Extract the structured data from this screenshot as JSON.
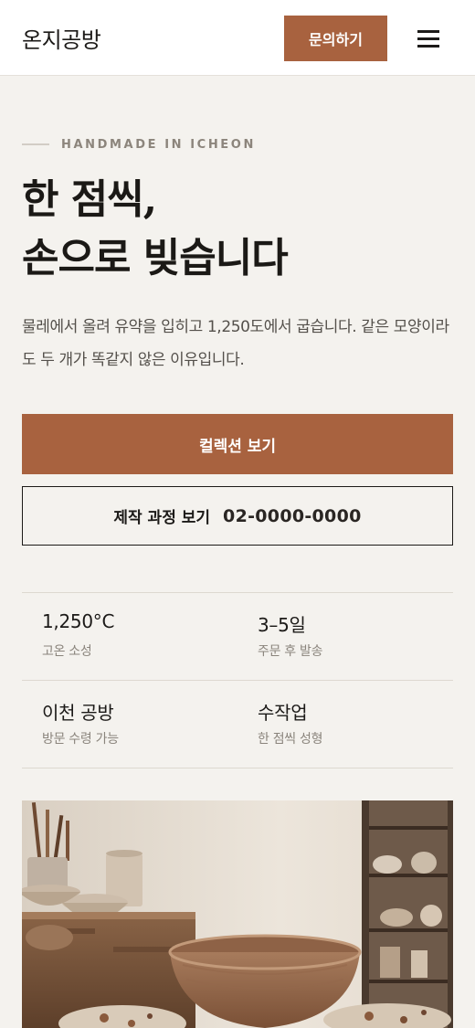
{
  "header": {
    "brand": "온지공방",
    "cta_label": "문의하기",
    "menu_icon": "hamburger-menu-icon"
  },
  "hero": {
    "eyebrow": "HANDMADE IN ICHEON",
    "title_line1": "한 점씩,",
    "title_line2": "손으로 빚습니다",
    "description": "물레에서 올려 유약을 입히고 1,250도에서 굽습니다. 같은 모양이라도 두 개가 똑같지 않은 이유입니다."
  },
  "actions": {
    "primary_label": "컬렉션 보기",
    "secondary_label": "제작 과정 보기",
    "phone": "02-0000-0000"
  },
  "stats": [
    {
      "value": "1,250°C",
      "label": "고온 소성"
    },
    {
      "value": "3–5일",
      "label": "주문 후 발송"
    },
    {
      "value": "이천 공방",
      "label": "방문 수령 가능"
    },
    {
      "value": "수작업",
      "label": "한 점씩 성형"
    }
  ],
  "colors": {
    "accent": "#a8623f",
    "background": "#f4f2ee",
    "text": "#1c1a18"
  }
}
